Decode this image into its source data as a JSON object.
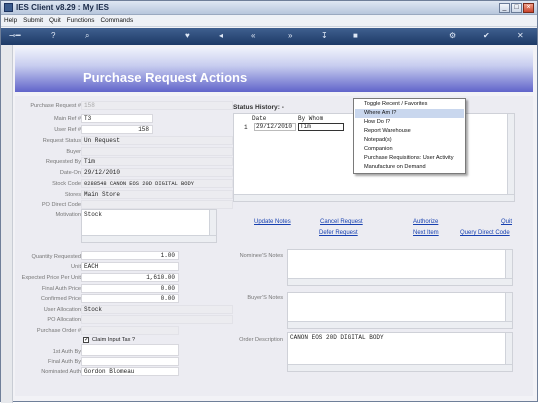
{
  "window": {
    "title": "IES Client v8.29 : My IES"
  },
  "menu": [
    "Help",
    "Submit",
    "Quit",
    "Functions",
    "Commands"
  ],
  "page_title": "Purchase Request Actions",
  "fields": [
    {
      "label": "Purchase Request #",
      "value": "158"
    },
    {
      "label": "Main Ref #",
      "value": "T3"
    },
    {
      "label": "User Ref #",
      "value": "158"
    },
    {
      "label": "Request Status",
      "value": "Un Request"
    },
    {
      "label": "Buyer",
      "value": ""
    },
    {
      "label": "Requested By",
      "value": "Tim"
    },
    {
      "label": "Date-On",
      "value": "29/12/2010"
    },
    {
      "label": "Stock Code",
      "value": "0288548 CANON EOS 20D DIGITAL BODY"
    },
    {
      "label": "Stores",
      "value": "Main Store"
    },
    {
      "label": "PO Direct Code",
      "value": ""
    },
    {
      "label": "Motivation",
      "value": "Stock"
    }
  ],
  "fields2": [
    {
      "label": "Quantity Requested",
      "value": "1.00"
    },
    {
      "label": "Unit",
      "value": "EACH"
    },
    {
      "label": "Expected Price Per Unit",
      "value": "1,610.00"
    },
    {
      "label": "Final Auth Price",
      "value": "0.00"
    },
    {
      "label": "Confirmed Price",
      "value": "0.00"
    },
    {
      "label": "User Allocation",
      "value": "Stock"
    },
    {
      "label": "PO Allocation",
      "value": ""
    },
    {
      "label": "Purchase Order #",
      "value": ""
    }
  ],
  "claim_input_tax": {
    "label": "Claim Input Tax ?",
    "checked": true
  },
  "fields3": [
    {
      "label": "1st Auth By",
      "value": ""
    },
    {
      "label": "Final Auth By",
      "value": ""
    },
    {
      "label": "Nominated Auth",
      "value": "Gordon Blomeau"
    }
  ],
  "status_history": {
    "title": "Status History: -",
    "col_date": "Date",
    "col_by": "By Whom",
    "rows": [
      {
        "n": "1",
        "date": "29/12/2010",
        "by": "Tim"
      }
    ]
  },
  "actions_row1": [
    "Update Notes",
    "Cancel Request",
    "Authorize",
    "Quit"
  ],
  "actions_row2": [
    "Defer Request",
    "Next Item",
    "Query Direct Code"
  ],
  "notes": {
    "nominee_label": "Nominee'S Notes",
    "buyer_label": "Buyer'S Notes",
    "order_desc_label": "Order Description",
    "order_desc": "CANON EOS 20D DIGITAL BODY"
  },
  "context_menu": [
    "Toggle Recent / Favorites",
    "Where Am I?",
    "How Do I?",
    "Report Warehouse",
    "Notepad(s)",
    "Companion",
    "Purchase Requisitions: User Activity",
    "Manufacture on Demand"
  ],
  "context_selected": 1
}
